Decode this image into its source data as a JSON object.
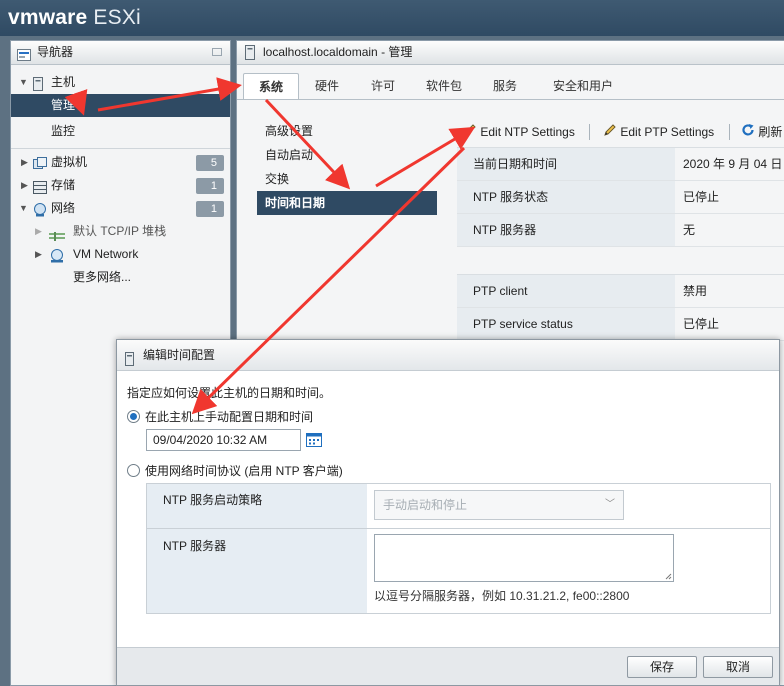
{
  "brand": {
    "vm": "vmware",
    "product": "ESXi"
  },
  "navigator": {
    "title": "导航器",
    "tree": [
      {
        "label": "主机"
      },
      {
        "label": "管理"
      },
      {
        "label": "监控"
      },
      {
        "label": "虚拟机",
        "count": "5"
      },
      {
        "label": "存储",
        "count": "1"
      },
      {
        "label": "网络",
        "count": "1"
      },
      {
        "label": "默认 TCP/IP 堆栈"
      },
      {
        "label": "VM Network"
      },
      {
        "label": "更多网络..."
      }
    ]
  },
  "main": {
    "title": "localhost.localdomain - 管理",
    "tabs": [
      "系统",
      "硬件",
      "许可",
      "软件包",
      "服务",
      "安全和用户"
    ],
    "subnav": [
      "高级设置",
      "自动启动",
      "交换",
      "时间和日期"
    ],
    "toolbar": {
      "edit_ntp": "Edit NTP Settings",
      "edit_ptp": "Edit PTP Settings",
      "refresh": "刷新"
    },
    "time_info": [
      {
        "key": "当前日期和时间",
        "value": "2020 年 9 月 04 日"
      },
      {
        "key": "NTP 服务状态",
        "value": "已停止"
      },
      {
        "key": "NTP 服务器",
        "value": "无"
      }
    ],
    "ptp_info": [
      {
        "key": "PTP client",
        "value": "禁用"
      },
      {
        "key": "PTP service status",
        "value": "已停止"
      }
    ]
  },
  "dialog": {
    "title": "编辑时间配置",
    "description": "指定应如何设置此主机的日期和时间。",
    "option_manual": "在此主机上手动配置日期和时间",
    "datetime_value": "09/04/2020 10:32 AM",
    "option_ntp": "使用网络时间协议 (启用 NTP 客户端)",
    "ntp_policy_label": "NTP 服务启动策略",
    "ntp_policy_value": "手动启动和停止",
    "ntp_servers_label": "NTP 服务器",
    "ntp_servers_hint": "以逗号分隔服务器，例如 10.31.21.2, fe00::2800",
    "save": "保存",
    "cancel": "取消"
  },
  "colors": {
    "brand_bar": "#2f4a63",
    "selected": "#2f4a63",
    "annotation_arrow": "#f0372f"
  }
}
